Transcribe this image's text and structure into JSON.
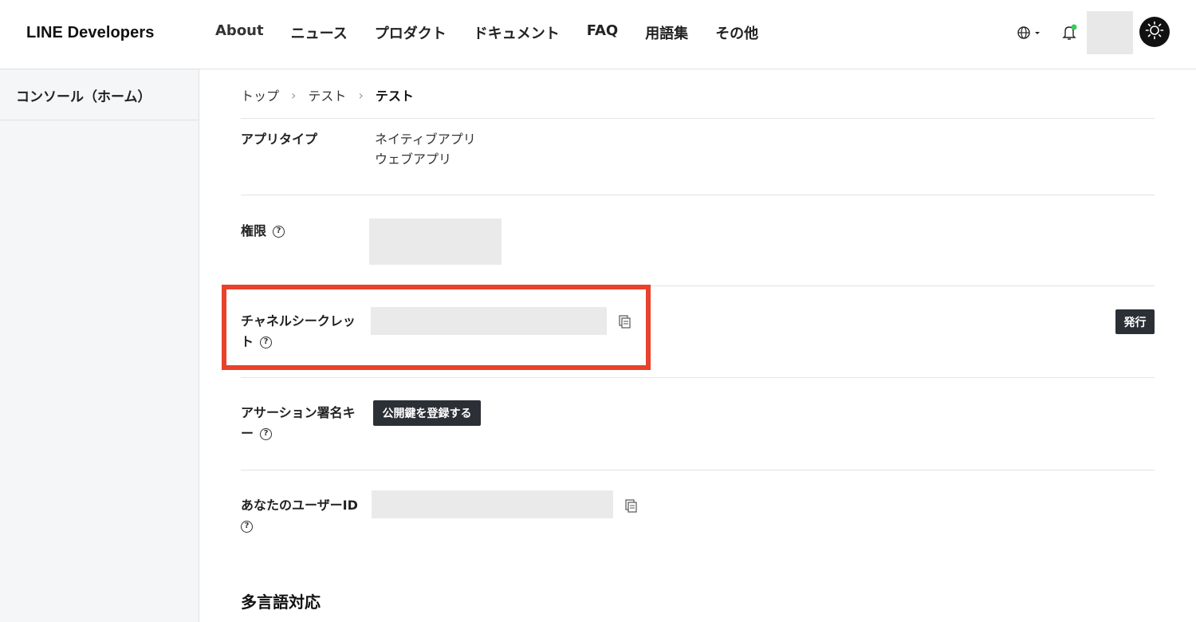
{
  "header": {
    "logo": "LINE Developers",
    "nav": [
      "About",
      "ニュース",
      "プロダクト",
      "ドキュメント",
      "FAQ",
      "用語集",
      "その他"
    ]
  },
  "sidebar": {
    "home_label": "コンソール（ホーム）"
  },
  "breadcrumb": {
    "items": [
      "トップ",
      "テスト",
      "テスト"
    ]
  },
  "rows": {
    "app_type": {
      "label": "アプリタイプ",
      "values": [
        "ネイティブアプリ",
        "ウェブアプリ"
      ]
    },
    "permissions": {
      "label": "権限",
      "help": "?"
    },
    "channel_secret": {
      "label_line1": "チャネルシークレッ",
      "label_line2": "ト",
      "help": "?",
      "issue_button": "発行"
    },
    "assertion_key": {
      "label_line1": "アサーション署名キ",
      "label_line2": "ー",
      "help": "?",
      "register_button": "公開鍵を登録する"
    },
    "user_id": {
      "label": "あなたのユーザーID",
      "help": "?"
    }
  },
  "section": {
    "title": "多言語対応"
  },
  "colors": {
    "highlight": "#e8412c",
    "dark_button": "#2b2f36",
    "notification_dot": "#3cc85a"
  },
  "icons": [
    "globe-icon",
    "bell-icon",
    "sun-icon",
    "copy-icon",
    "help-icon"
  ]
}
